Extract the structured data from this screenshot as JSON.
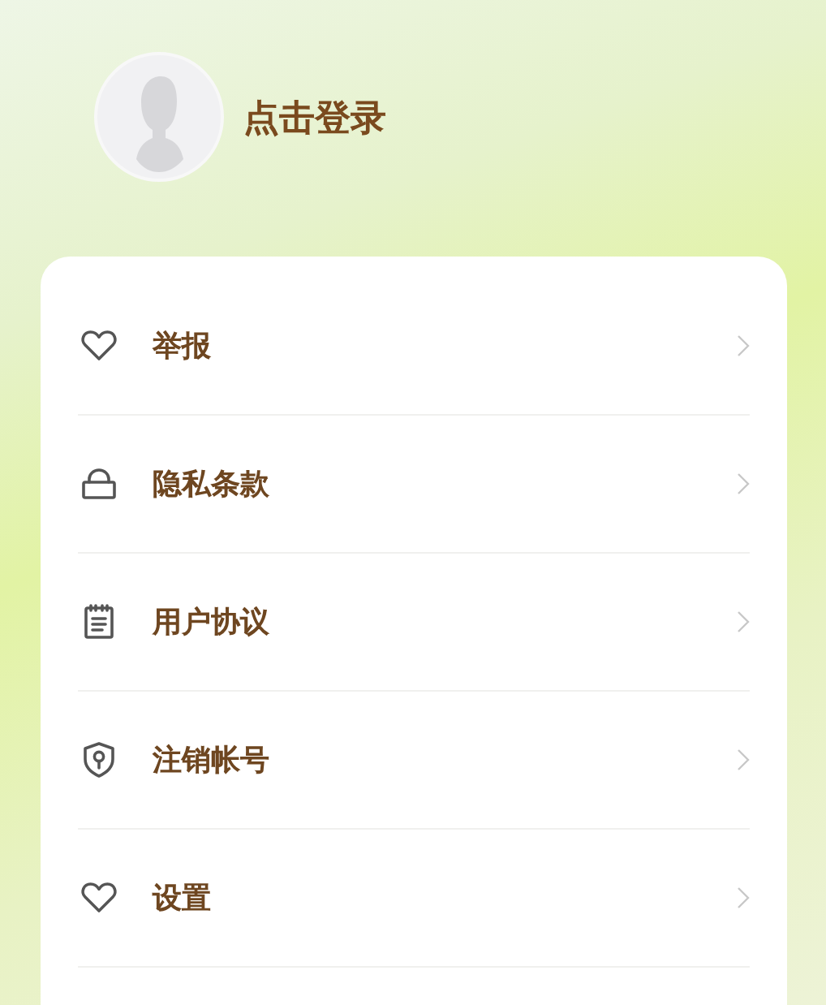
{
  "profile": {
    "login_label": "点击登录"
  },
  "menu": [
    {
      "kind": "heart",
      "label": "举报"
    },
    {
      "kind": "lock",
      "label": "隐私条款"
    },
    {
      "kind": "notepad",
      "label": "用户协议"
    },
    {
      "kind": "shield",
      "label": "注销帐号"
    },
    {
      "kind": "heart",
      "label": "设置"
    }
  ]
}
